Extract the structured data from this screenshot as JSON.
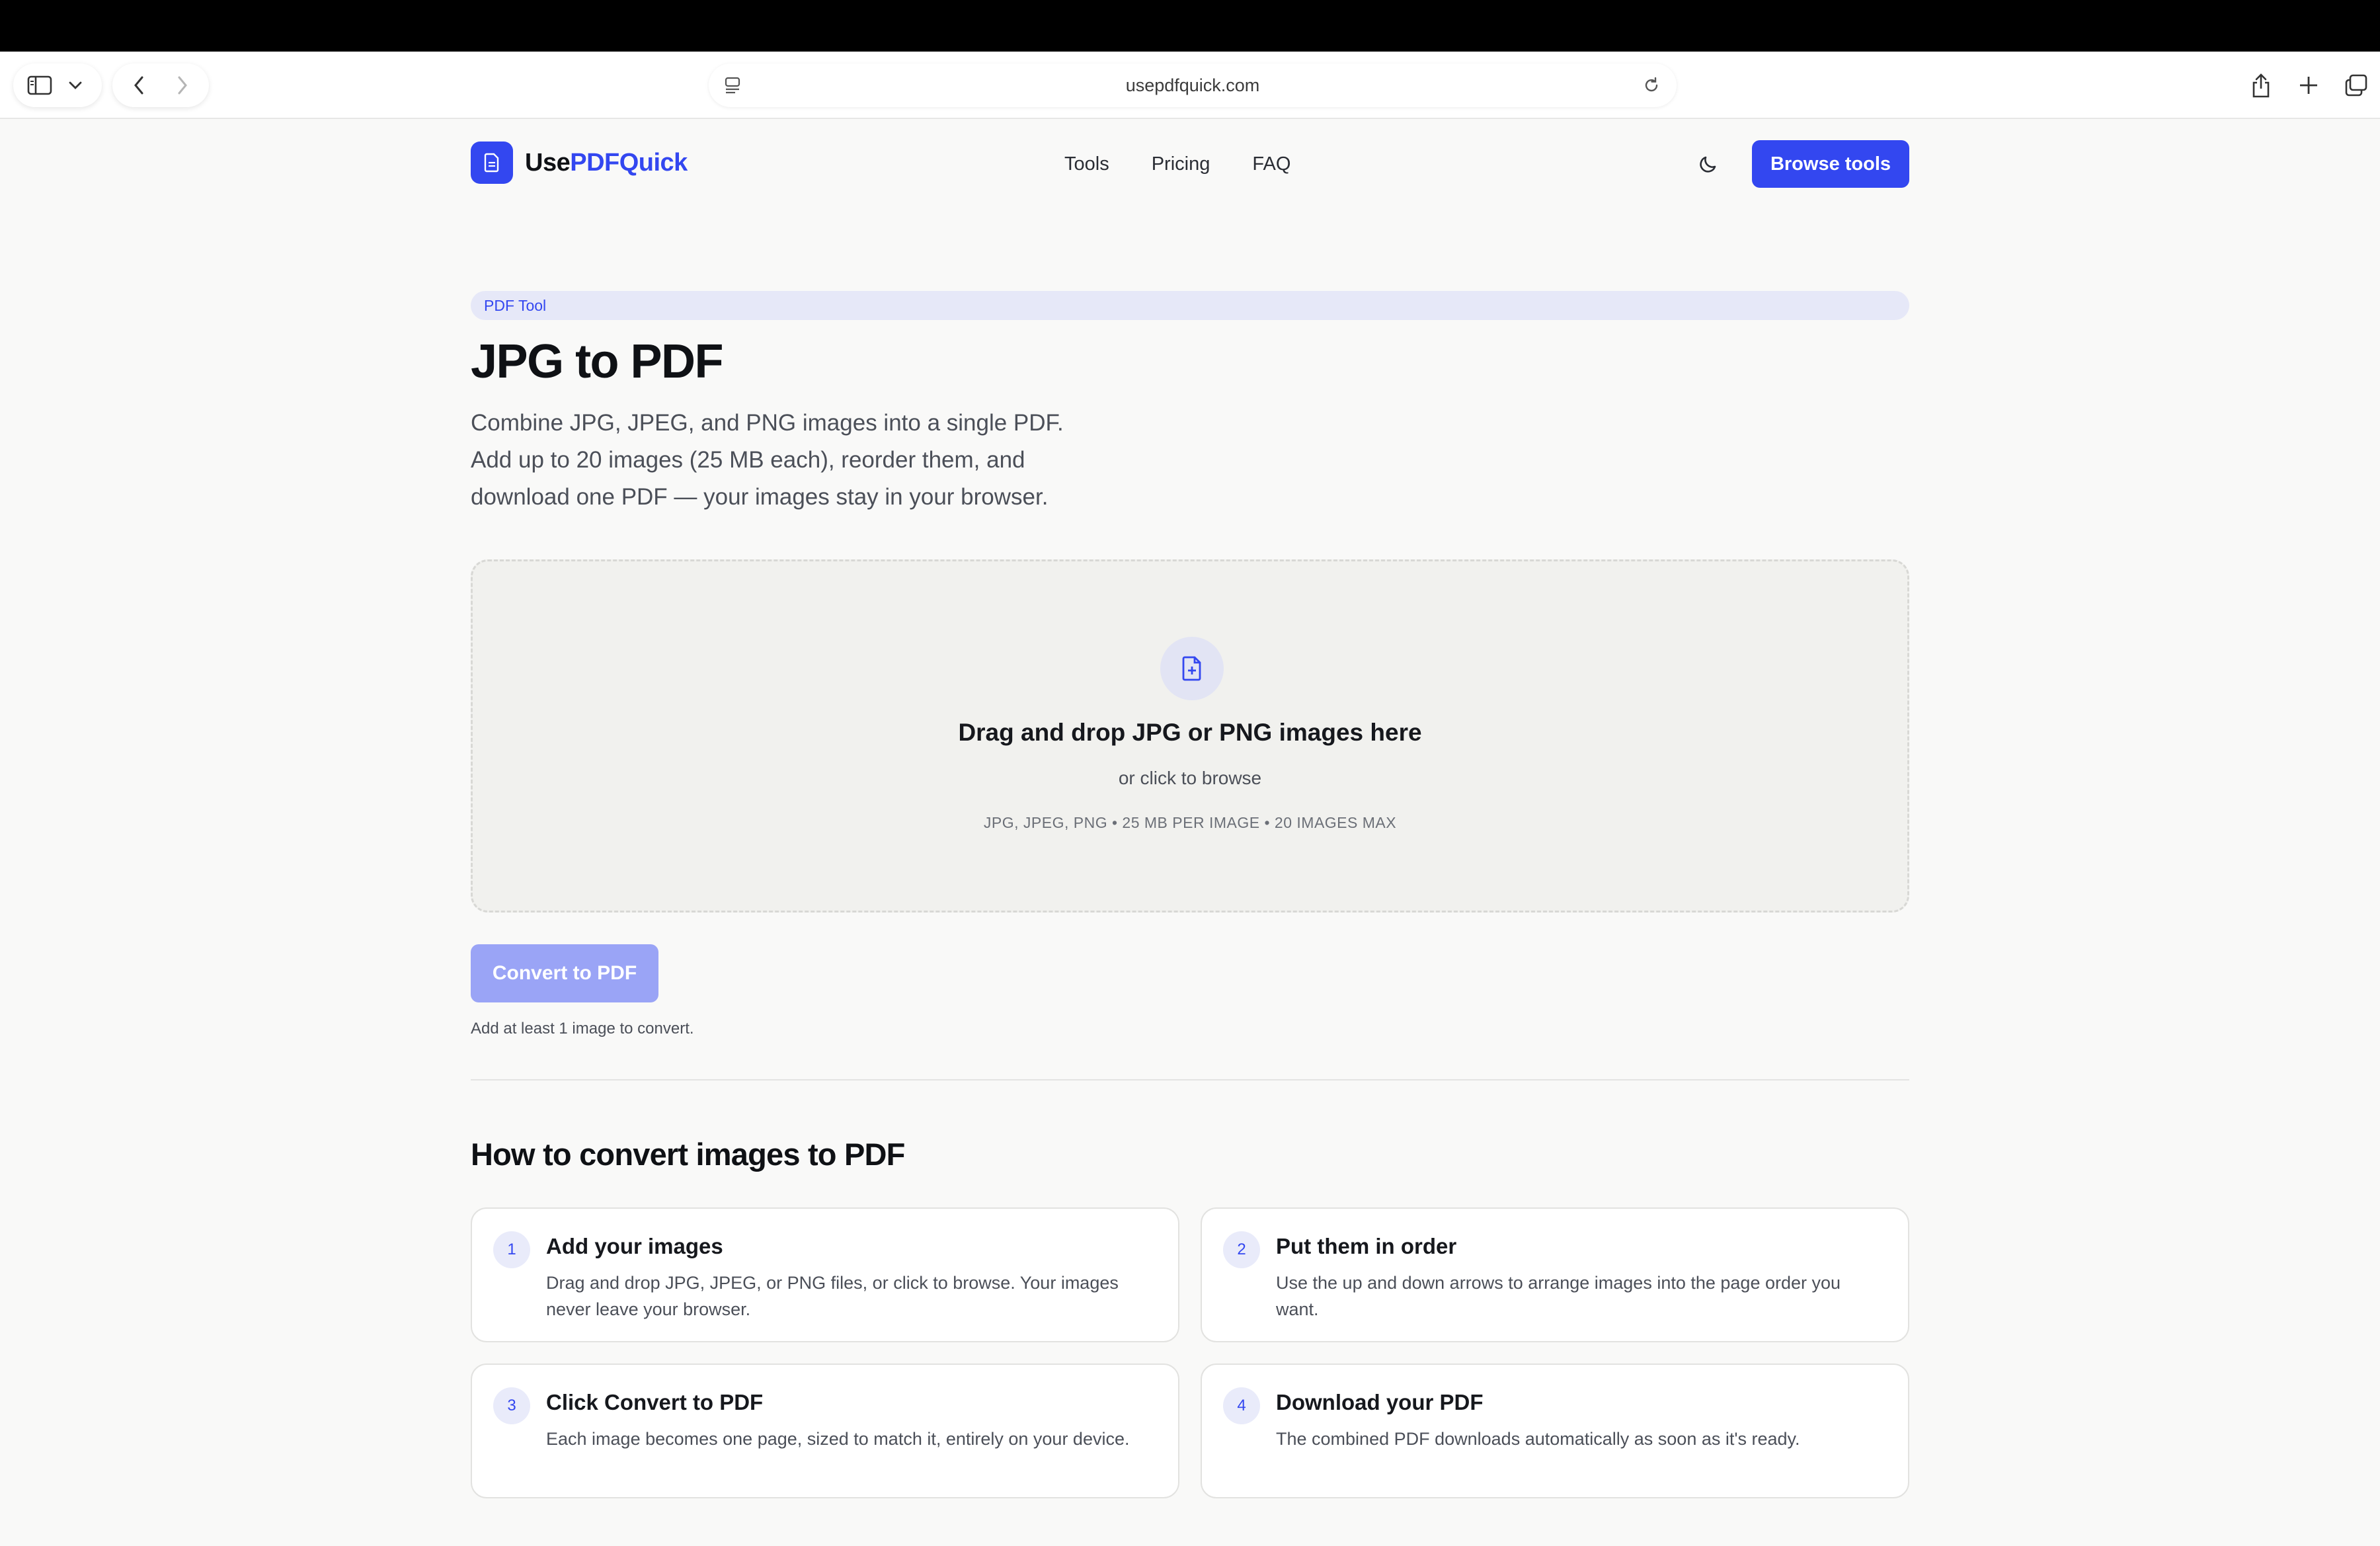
{
  "browser": {
    "url": "usepdfquick.com"
  },
  "header": {
    "logo_prefix": "Use",
    "logo_suffix": "PDFQuick",
    "nav": [
      "Tools",
      "Pricing",
      "FAQ"
    ],
    "browse_label": "Browse tools"
  },
  "hero": {
    "badge": "PDF Tool",
    "title": "JPG to PDF",
    "description": "Combine JPG, JPEG, and PNG images into a single PDF. Add up to 20 images (25 MB each), reorder them, and download one PDF — your images stay in your browser."
  },
  "dropzone": {
    "title": "Drag and drop JPG or PNG images here",
    "subtitle": "or click to browse",
    "meta": "JPG, JPEG, PNG • 25 MB PER IMAGE • 20 IMAGES MAX"
  },
  "convert": {
    "label": "Convert to PDF",
    "hint": "Add at least 1 image to convert."
  },
  "howto": {
    "title": "How to convert images to PDF",
    "steps": [
      {
        "num": "1",
        "title": "Add your images",
        "text": "Drag and drop JPG, JPEG, or PNG files, or click to browse. Your images never leave your browser."
      },
      {
        "num": "2",
        "title": "Put them in order",
        "text": "Use the up and down arrows to arrange images into the page order you want."
      },
      {
        "num": "3",
        "title": "Click Convert to PDF",
        "text": "Each image becomes one page, sized to match it, entirely on your device."
      },
      {
        "num": "4",
        "title": "Download your PDF",
        "text": "The combined PDF downloads automatically as soon as it's ready."
      }
    ]
  },
  "colors": {
    "brand": "#3347f0",
    "brand_disabled": "#9aa4f6",
    "badge_bg": "#e6e8f8"
  }
}
